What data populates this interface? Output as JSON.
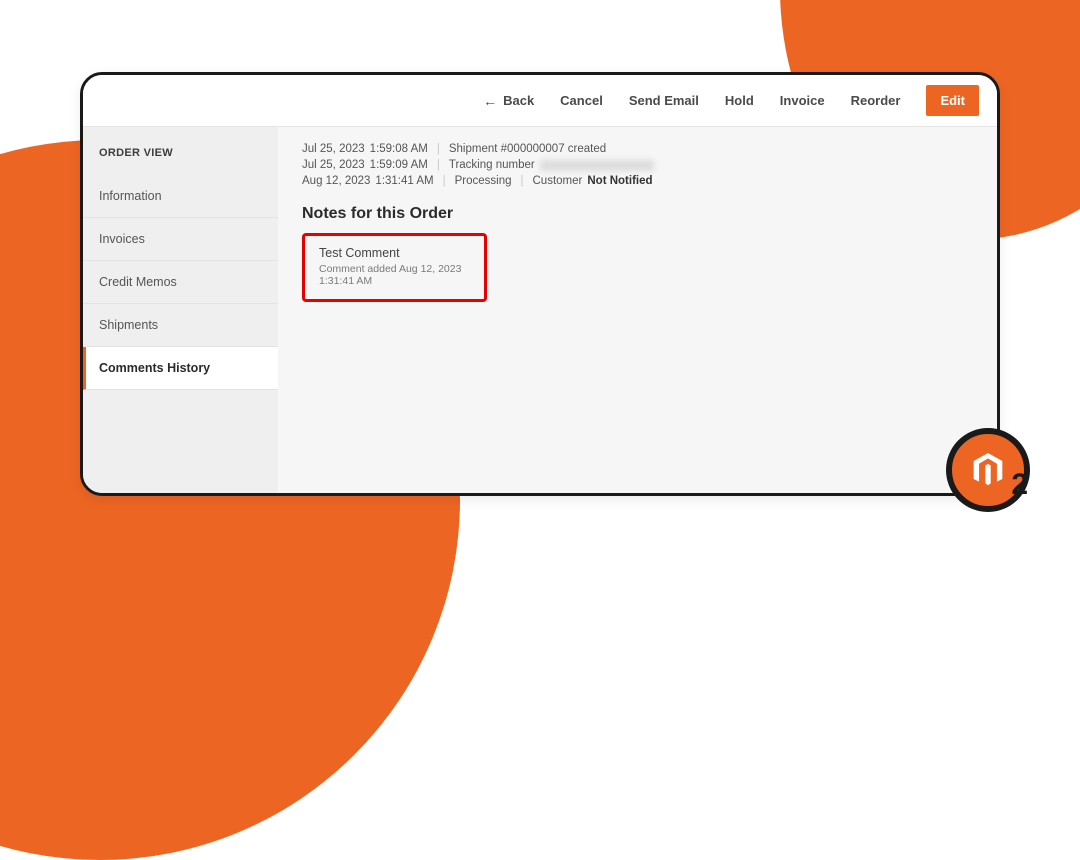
{
  "toolbar": {
    "back": "Back",
    "cancel": "Cancel",
    "send": "Send Email",
    "hold": "Hold",
    "invoice": "Invoice",
    "reorder": "Reorder",
    "edit": "Edit"
  },
  "sidebar": {
    "title": "ORDER VIEW",
    "items": [
      {
        "label": "Information"
      },
      {
        "label": "Invoices"
      },
      {
        "label": "Credit Memos"
      },
      {
        "label": "Shipments"
      },
      {
        "label": "Comments History"
      }
    ],
    "active_index": 4
  },
  "log": [
    {
      "date": "Jul 25, 2023",
      "time": "1:59:08 AM",
      "text": "Shipment #000000007 created",
      "blur_after": false
    },
    {
      "date": "Jul 25, 2023",
      "time": "1:59:09 AM",
      "text": "Tracking number",
      "blur_after": true
    },
    {
      "date": "Aug 12, 2023",
      "time": "1:31:41 AM",
      "text": "Processing",
      "extra_label": "Customer",
      "extra_bold": "Not Notified"
    }
  ],
  "notes": {
    "heading": "Notes for this Order",
    "comment_title": "Test Comment",
    "comment_meta": "Comment added Aug 12, 2023 1:31:41 AM"
  },
  "badge": {
    "version": "2"
  }
}
